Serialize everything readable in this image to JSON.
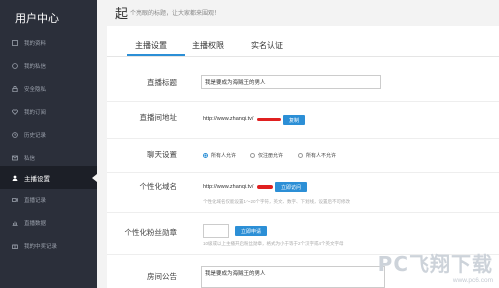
{
  "sidebar": {
    "title": "用户中心",
    "items": [
      {
        "label": "我的资料"
      },
      {
        "label": "我的私信"
      },
      {
        "label": "安全隐私"
      },
      {
        "label": "我的订阅"
      },
      {
        "label": "历史记录"
      },
      {
        "label": "私信"
      },
      {
        "label": "主播设置"
      },
      {
        "label": "直播记录"
      },
      {
        "label": "直播数据"
      },
      {
        "label": "我的中奖记录"
      }
    ]
  },
  "header": {
    "big_char": "起",
    "subtitle": "个亮眼的标题，让大家都来围观！"
  },
  "tabs": [
    {
      "label": "主播设置"
    },
    {
      "label": "主播权限"
    },
    {
      "label": "实名认证"
    }
  ],
  "form": {
    "title_label": "直播标题",
    "title_value": "我是要成为海贼王的男人",
    "address_label": "直播间地址",
    "address_value": "http://www.zhanqi.tv/",
    "copy_button": "复制",
    "chat_label": "聊天设置",
    "chat_options": [
      "所有人允许",
      "仅注册允许",
      "所有人不允许"
    ],
    "domain_label": "个性化域名",
    "domain_value": "http://www.zhanqi.tv/",
    "visit_button": "立即访问",
    "domain_hint": "个性化域名仅能设置1～20个字符，英文、数字、下划线，设置后不可修改",
    "badge_label": "个性化粉丝勋章",
    "badge_value": "",
    "apply_button": "立即申请",
    "badge_hint": "10级或以上主播开启粉丝勋章，格式为小于等于2个汉字或4个英文字母",
    "notice_label": "房间公告",
    "notice_value": "我是要成为海贼王的男人"
  },
  "watermark": {
    "brand": "PC飞翔下载",
    "url": "www.pc6.com"
  },
  "colors": {
    "sidebar_bg": "#2b2f3a",
    "accent": "#2c8fd6",
    "redact": "#e02020"
  }
}
